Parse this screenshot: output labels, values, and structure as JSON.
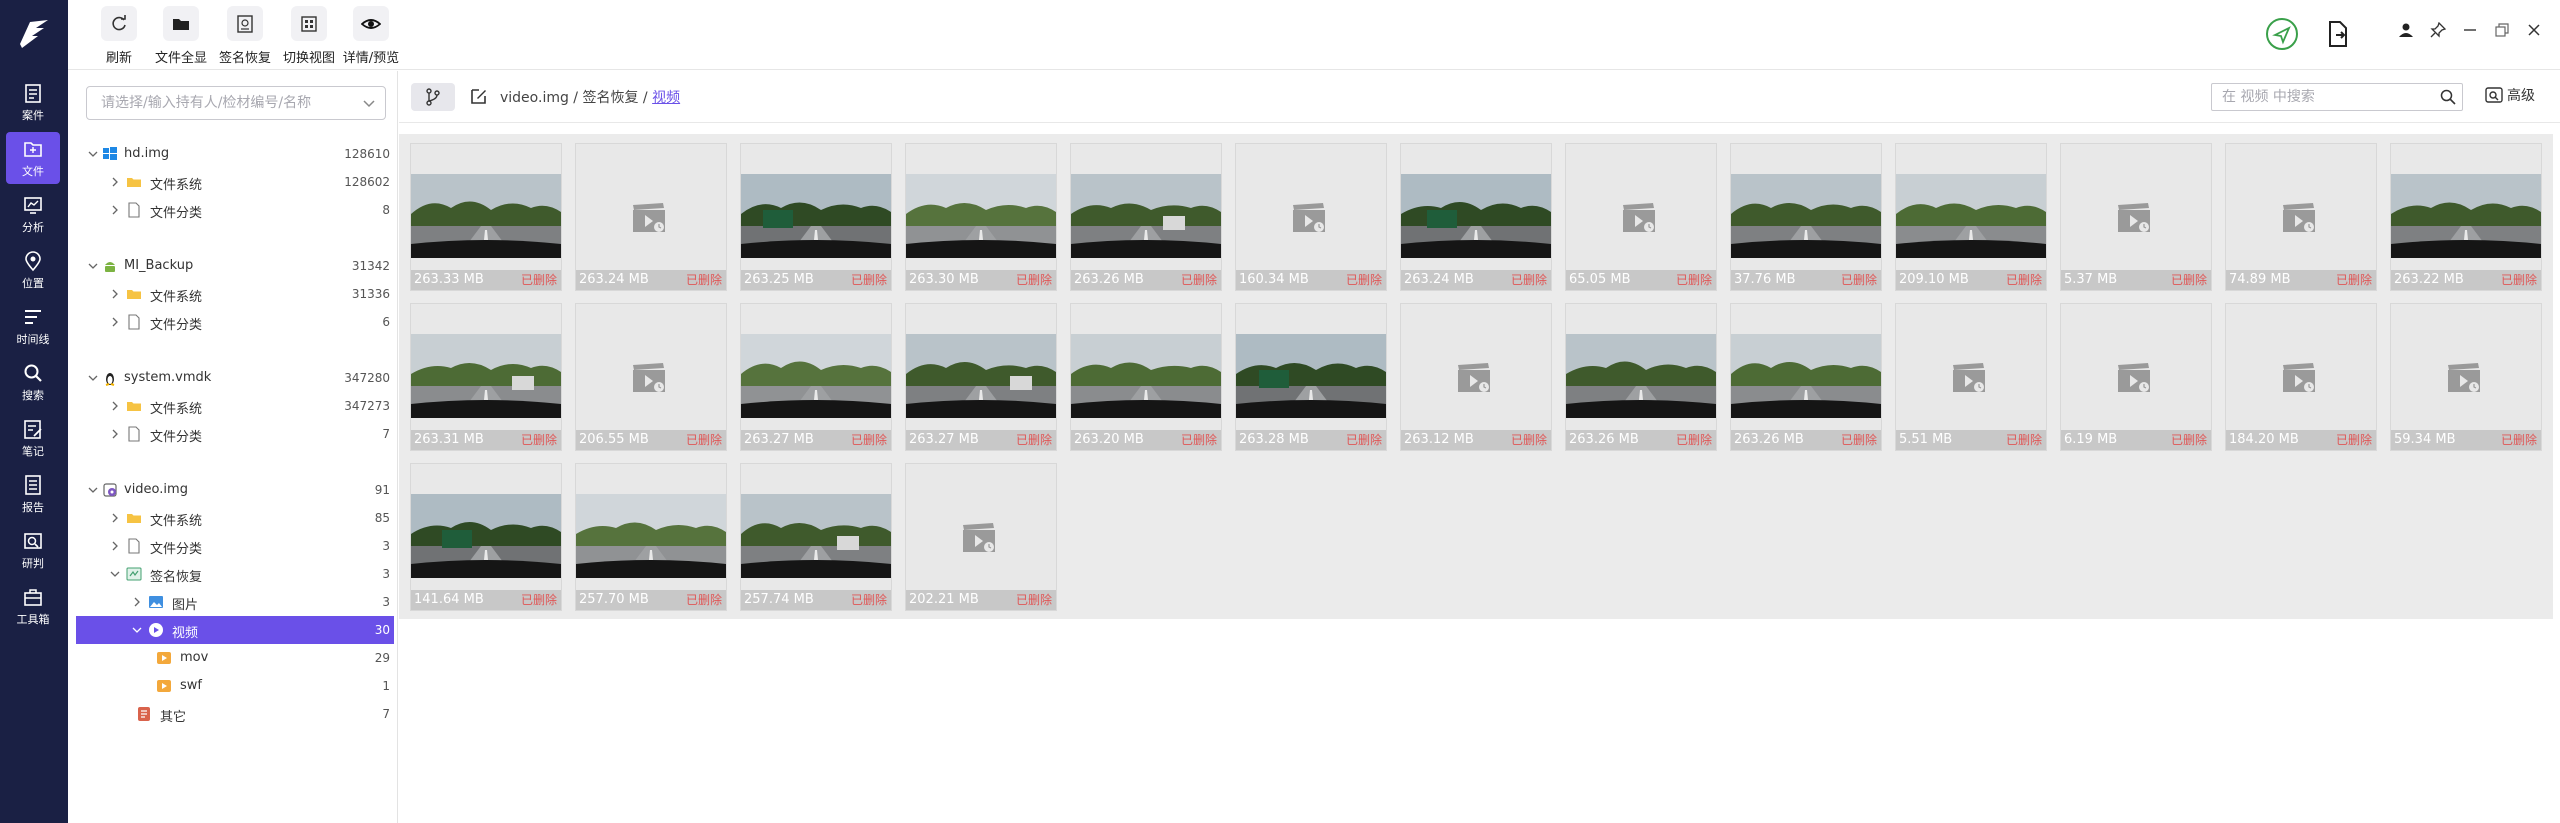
{
  "toolbar": {
    "buttons": [
      {
        "label": "刷新",
        "icon": "refresh-icon"
      },
      {
        "label": "文件全显",
        "icon": "folder-icon"
      },
      {
        "label": "签名恢复",
        "icon": "signature-icon"
      },
      {
        "label": "切换视图",
        "icon": "switch-view-icon"
      },
      {
        "label": "详情/预览",
        "icon": "eye-icon"
      }
    ]
  },
  "rail": {
    "items": [
      {
        "label": "案件",
        "icon": "case-icon",
        "active": false
      },
      {
        "label": "文件",
        "icon": "file-icon",
        "active": true
      },
      {
        "label": "分析",
        "icon": "analysis-icon",
        "active": false
      },
      {
        "label": "位置",
        "icon": "location-icon",
        "active": false
      },
      {
        "label": "时间线",
        "icon": "timeline-icon",
        "active": false
      },
      {
        "label": "搜索",
        "icon": "search-icon",
        "active": false
      },
      {
        "label": "笔记",
        "icon": "note-icon",
        "active": false
      },
      {
        "label": "报告",
        "icon": "report-icon",
        "active": false
      },
      {
        "label": "研判",
        "icon": "judge-icon",
        "active": false
      },
      {
        "label": "工具箱",
        "icon": "toolbox-icon",
        "active": false
      }
    ]
  },
  "left": {
    "select_placeholder": "请选择/输入持有人/检材编号/名称",
    "tree": [
      {
        "label": "hd.img",
        "count": "128610",
        "icon": "windows-icon",
        "level": 0
      },
      {
        "label": "文件系统",
        "count": "128602",
        "icon": "folder-icon",
        "level": 1
      },
      {
        "label": "文件分类",
        "count": "8",
        "icon": "doc-icon",
        "level": 1
      },
      {
        "label": "MI_Backup",
        "count": "31342",
        "icon": "android-icon",
        "level": 0
      },
      {
        "label": "文件系统",
        "count": "31336",
        "icon": "folder-icon",
        "level": 1
      },
      {
        "label": "文件分类",
        "count": "6",
        "icon": "doc-icon",
        "level": 1
      },
      {
        "label": "system.vmdk",
        "count": "347280",
        "icon": "linux-icon",
        "level": 0
      },
      {
        "label": "文件系统",
        "count": "347273",
        "icon": "folder-icon",
        "level": 1
      },
      {
        "label": "文件分类",
        "count": "7",
        "icon": "doc-icon",
        "level": 1
      },
      {
        "label": "video.img",
        "count": "91",
        "icon": "disk-image-icon",
        "level": 0
      },
      {
        "label": "文件系统",
        "count": "85",
        "icon": "folder-icon",
        "level": 1
      },
      {
        "label": "文件分类",
        "count": "3",
        "icon": "doc-icon",
        "level": 1
      },
      {
        "label": "签名恢复",
        "count": "3",
        "icon": "signature-icon",
        "level": 1
      },
      {
        "label": "图片",
        "count": "3",
        "icon": "image-icon",
        "level": 2
      },
      {
        "label": "视频",
        "count": "30",
        "icon": "video-icon",
        "level": 2
      },
      {
        "label": "mov",
        "count": "29",
        "icon": "mov-icon",
        "level": 3
      },
      {
        "label": "swf",
        "count": "1",
        "icon": "swf-icon",
        "level": 3
      },
      {
        "label": "其它",
        "count": "7",
        "icon": "other-icon",
        "level": 2
      }
    ]
  },
  "main": {
    "crumbs": {
      "part1": "video.img",
      "sep": " / ",
      "part2": "签名恢复",
      "current": "视频"
    },
    "search_placeholder": "在 视频 中搜索",
    "advanced_label": "高级",
    "colors": {
      "accent": "#6a50e8",
      "deleted": "#e05656",
      "rail": "#1a2044"
    },
    "tiles": [
      {
        "size": "263.33 MB",
        "state": "已删除",
        "thumb": true
      },
      {
        "size": "263.24 MB",
        "state": "已删除",
        "thumb": false
      },
      {
        "size": "263.25 MB",
        "state": "已删除",
        "thumb": true
      },
      {
        "size": "263.30 MB",
        "state": "已删除",
        "thumb": true
      },
      {
        "size": "263.26 MB",
        "state": "已删除",
        "thumb": true
      },
      {
        "size": "160.34 MB",
        "state": "已删除",
        "thumb": false
      },
      {
        "size": "263.24 MB",
        "state": "已删除",
        "thumb": true
      },
      {
        "size": "65.05 MB",
        "state": "已删除",
        "thumb": false
      },
      {
        "size": "37.76 MB",
        "state": "已删除",
        "thumb": true
      },
      {
        "size": "209.10 MB",
        "state": "已删除",
        "thumb": true
      },
      {
        "size": "5.37 MB",
        "state": "已删除",
        "thumb": false
      },
      {
        "size": "74.89 MB",
        "state": "已删除",
        "thumb": false
      },
      {
        "size": "263.22 MB",
        "state": "已删除",
        "thumb": true
      },
      {
        "size": "263.31 MB",
        "state": "已删除",
        "thumb": true
      },
      {
        "size": "206.55 MB",
        "state": "已删除",
        "thumb": false
      },
      {
        "size": "263.27 MB",
        "state": "已删除",
        "thumb": true
      },
      {
        "size": "263.27 MB",
        "state": "已删除",
        "thumb": true
      },
      {
        "size": "263.20 MB",
        "state": "已删除",
        "thumb": true
      },
      {
        "size": "263.28 MB",
        "state": "已删除",
        "thumb": true
      },
      {
        "size": "263.12 MB",
        "state": "已删除",
        "thumb": false
      },
      {
        "size": "263.26 MB",
        "state": "已删除",
        "thumb": true
      },
      {
        "size": "263.26 MB",
        "state": "已删除",
        "thumb": true
      },
      {
        "size": "5.51 MB",
        "state": "已删除",
        "thumb": false
      },
      {
        "size": "6.19 MB",
        "state": "已删除",
        "thumb": false
      },
      {
        "size": "184.20 MB",
        "state": "已删除",
        "thumb": false
      },
      {
        "size": "59.34 MB",
        "state": "已删除",
        "thumb": false
      },
      {
        "size": "141.64 MB",
        "state": "已删除",
        "thumb": true
      },
      {
        "size": "257.70 MB",
        "state": "已删除",
        "thumb": true
      },
      {
        "size": "257.74 MB",
        "state": "已删除",
        "thumb": true
      },
      {
        "size": "202.21 MB",
        "state": "已删除",
        "thumb": false
      }
    ]
  }
}
